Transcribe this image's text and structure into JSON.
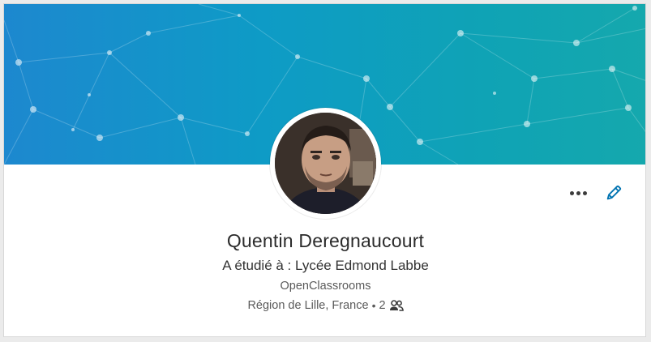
{
  "profile": {
    "name": "Quentin Deregnaucourt",
    "headline": "A étudié à : Lycée Edmond Labbe",
    "company": "OpenClassrooms",
    "location": "Région de Lille, France",
    "separator": "•",
    "connections": "2"
  },
  "icons": {
    "more": "more-horizontal-icon",
    "edit": "pencil-icon",
    "connections": "people-icon"
  },
  "colors": {
    "banner_start": "#1d88cf",
    "banner_end": "#15a8ad",
    "accent": "#0073b1"
  }
}
